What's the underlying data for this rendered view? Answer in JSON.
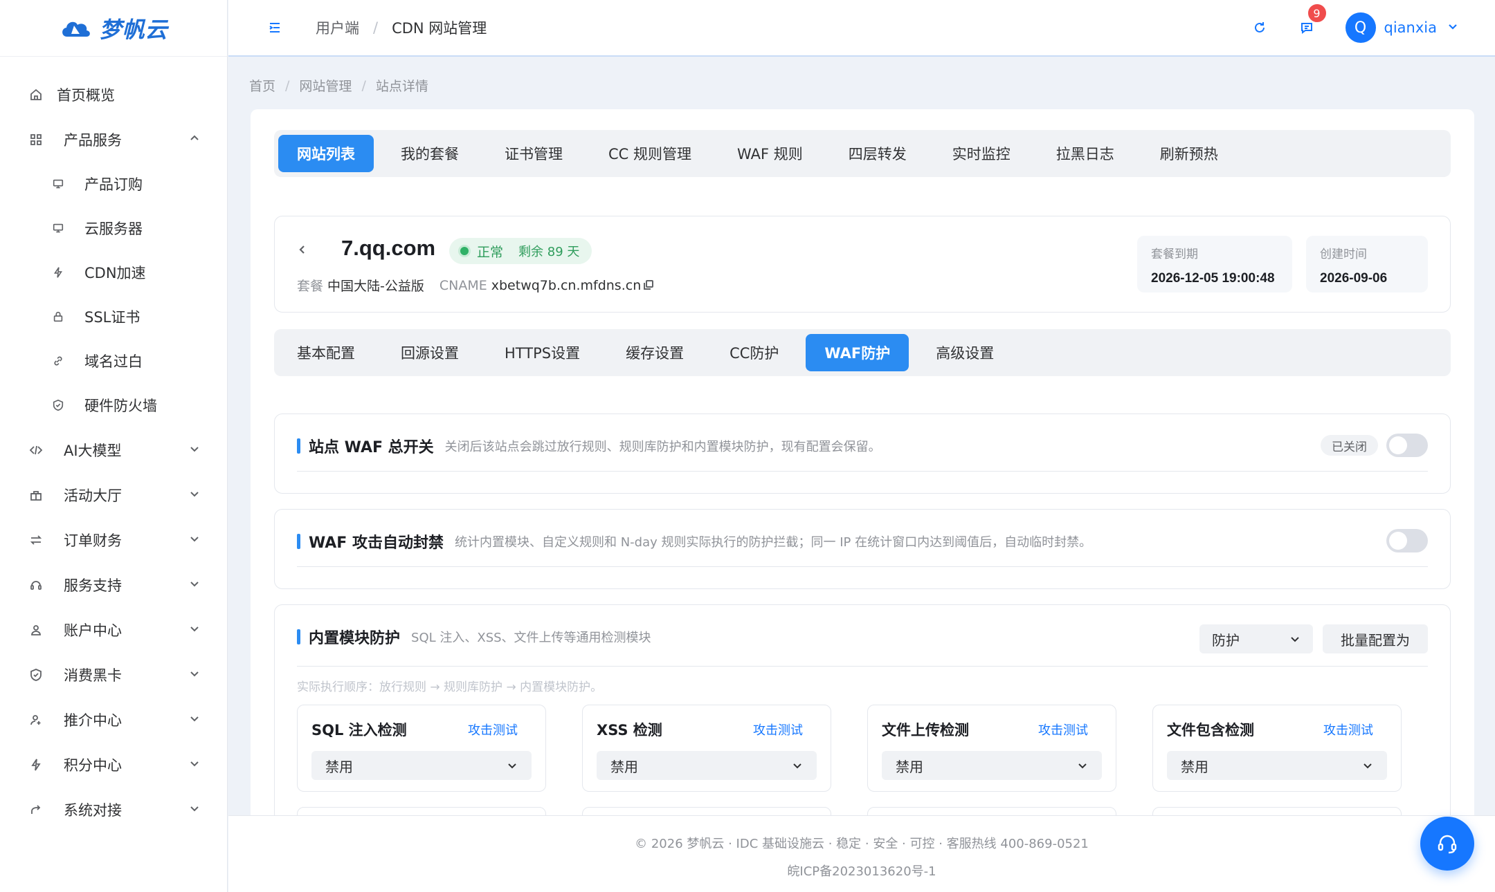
{
  "brand": {
    "name": "梦帆云"
  },
  "sidebar": {
    "items": [
      {
        "label": "首页概览",
        "icon": "home-icon"
      },
      {
        "label": "产品服务",
        "icon": "grid-icon",
        "expanded": true,
        "children": [
          {
            "label": "产品订购",
            "icon": "monitor-icon"
          },
          {
            "label": "云服务器",
            "icon": "monitor-icon"
          },
          {
            "label": "CDN加速",
            "icon": "bolt-icon"
          },
          {
            "label": "SSL证书",
            "icon": "lock-icon"
          },
          {
            "label": "域名过白",
            "icon": "link-icon"
          },
          {
            "label": "硬件防火墙",
            "icon": "shield-icon"
          }
        ]
      },
      {
        "label": "AI大模型",
        "icon": "code-icon"
      },
      {
        "label": "活动大厅",
        "icon": "gift-icon"
      },
      {
        "label": "订单财务",
        "icon": "swap-icon"
      },
      {
        "label": "服务支持",
        "icon": "headset-icon"
      },
      {
        "label": "账户中心",
        "icon": "user-icon"
      },
      {
        "label": "消费黑卡",
        "icon": "shield-icon"
      },
      {
        "label": "推介中心",
        "icon": "user-plus-icon"
      },
      {
        "label": "积分中心",
        "icon": "bolt-icon"
      },
      {
        "label": "系统对接",
        "icon": "share-icon"
      }
    ]
  },
  "header": {
    "breadcrumb": [
      "用户端",
      "CDN 网站管理"
    ],
    "badge_count": "9",
    "user": {
      "initial": "Q",
      "name": "qianxia"
    }
  },
  "page_breadcrumb": [
    "首页",
    "网站管理",
    "站点详情"
  ],
  "top_tabs": [
    "网站列表",
    "我的套餐",
    "证书管理",
    "CC 规则管理",
    "WAF 规则",
    "四层转发",
    "实时监控",
    "拉黑日志",
    "刷新预热"
  ],
  "top_tabs_active": 0,
  "site": {
    "domain": "7.qq.com",
    "status": "正常",
    "remaining": "剩余 89 天",
    "plan_label": "套餐",
    "plan": "中国大陆-公益版",
    "cname_label": "CNAME",
    "cname": "xbetwq7b.cn.mfdns.cn",
    "expire_label": "套餐到期",
    "expire": "2026-12-05 19:00:48",
    "created_label": "创建时间",
    "created": "2026-09-06"
  },
  "sub_tabs": [
    "基本配置",
    "回源设置",
    "HTTPS设置",
    "缓存设置",
    "CC防护",
    "WAF防护",
    "高级设置"
  ],
  "sub_tabs_active": 5,
  "waf_switch": {
    "title": "站点 WAF 总开关",
    "desc": "关闭后该站点会跳过放行规则、规则库防护和内置模块防护，现有配置会保留。",
    "state_label": "已关闭",
    "on": false
  },
  "auto_ban": {
    "title": "WAF 攻击自动封禁",
    "desc": "统计内置模块、自定义规则和 N-day 规则实际执行的防护拦截；同一 IP 在统计窗口内达到阈值后，自动临时封禁。",
    "on": false
  },
  "builtin": {
    "title": "内置模块防护",
    "desc": "SQL 注入、XSS、文件上传等通用检测模块",
    "mode": "防护",
    "batch_label": "批量配置为",
    "order_note": "实际执行顺序：放行规则 → 规则库防护 → 内置模块防护。",
    "modules": [
      {
        "name": "SQL 注入检测",
        "test": "攻击测试",
        "value": "禁用"
      },
      {
        "name": "XSS 检测",
        "test": "攻击测试",
        "value": "禁用"
      },
      {
        "name": "文件上传检测",
        "test": "攻击测试",
        "value": "禁用"
      },
      {
        "name": "文件包含检测",
        "test": "攻击测试",
        "value": "禁用"
      }
    ]
  },
  "footer": {
    "line1": "© 2026 梦帆云 · IDC 基础设施云 · 稳定 · 安全 · 可控 · 客服热线 400-869-0521",
    "line2": "皖ICP备2023013620号-1"
  },
  "colors": {
    "accent": "#2b8cf2",
    "success": "#2e9c5b",
    "danger": "#f04c4c"
  }
}
